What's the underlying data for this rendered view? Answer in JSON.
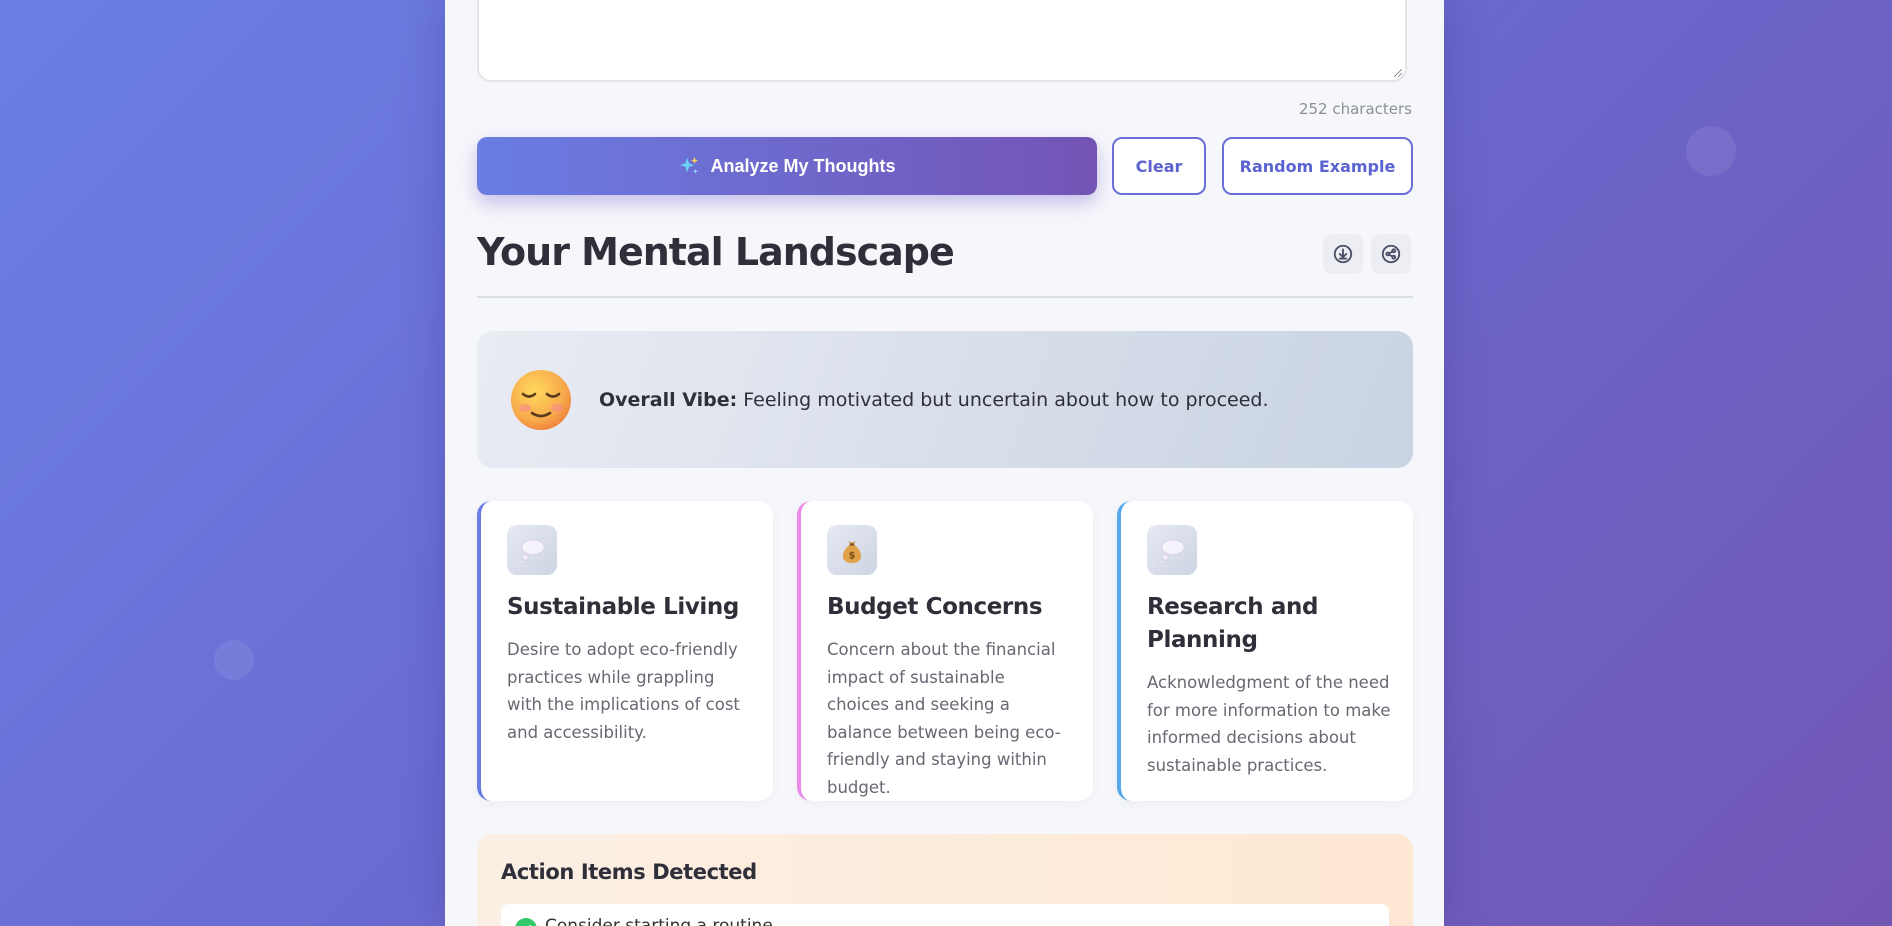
{
  "input": {
    "char_count": "252 characters"
  },
  "buttons": {
    "analyze": "Analyze My Thoughts",
    "clear": "Clear",
    "random": "Random Example"
  },
  "results": {
    "title": "Your Mental Landscape",
    "download_icon": "download-icon",
    "share_icon": "share-icon"
  },
  "vibe": {
    "emoji_icon": "relieved-face-emoji",
    "label": "Overall Vibe:",
    "text": "Feeling motivated but uncertain about how to proceed."
  },
  "themes": [
    {
      "icon": "thought-bubble-icon",
      "accent": "#6a7de3",
      "title": "Sustainable Living",
      "description": "Desire to adopt eco-friendly practices while grappling with the implications of cost and accessibility."
    },
    {
      "icon": "money-bag-icon",
      "accent": "#ec8ae8",
      "title": "Budget Concerns",
      "description": "Concern about the financial impact of sustainable choices and seeking a balance between being eco-friendly and staying within budget."
    },
    {
      "icon": "thought-bubble-icon",
      "accent": "#58a8ec",
      "title": "Research and Planning",
      "description": "Acknowledgment of the need for more information to make informed decisions about sustainable practices."
    }
  ],
  "action_items": {
    "title": "Action Items Detected",
    "items": [
      {
        "text": "Consider starting a routine"
      }
    ]
  }
}
